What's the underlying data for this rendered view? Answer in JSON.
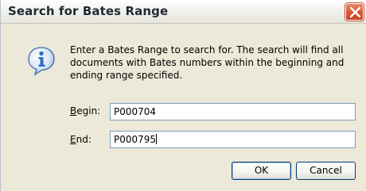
{
  "dialog": {
    "title": "Search for Bates Range",
    "message": "Enter a Bates Range to search for.  The search will find all documents with Bates numbers within the beginning and ending range specified.",
    "begin": {
      "label_mnemonic": "B",
      "label_rest": "egin:",
      "value": "P000704"
    },
    "end": {
      "label_mnemonic": "E",
      "label_rest": "nd:",
      "value": "P000795"
    },
    "ok_label": "OK",
    "cancel_label": "Cancel"
  },
  "icons": {
    "info": "info-icon",
    "close": "close-icon"
  },
  "colors": {
    "close_button": "#d95a37",
    "info_icon": "#2f6fc0",
    "dialog_bg": "#ece9d8"
  }
}
